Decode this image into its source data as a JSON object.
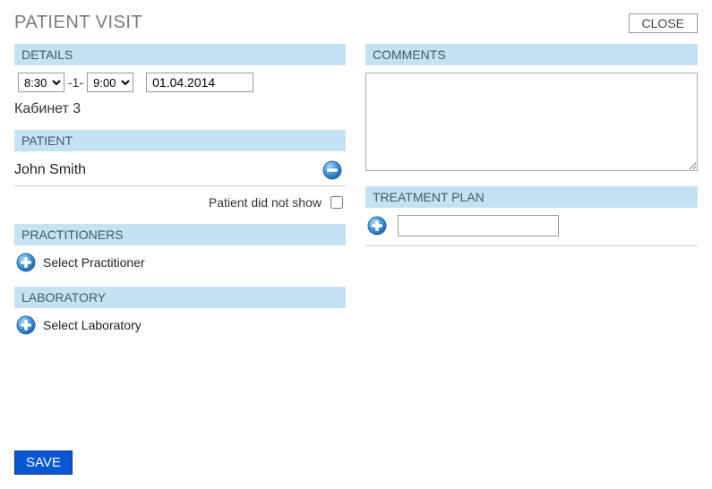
{
  "header": {
    "title": "PATIENT VISIT",
    "close_label": "CLOSE"
  },
  "details": {
    "header": "DETAILS",
    "time_start": "8:30",
    "time_end": "9:00",
    "separator": "-1-",
    "date": "01.04.2014",
    "cabinet": "Кабинет 3"
  },
  "patient": {
    "header": "PATIENT",
    "name": "John Smith",
    "noshow_label": "Patient did not show"
  },
  "practitioners": {
    "header": "PRACTITIONERS",
    "add_label": "Select Practitioner"
  },
  "laboratory": {
    "header": "LABORATORY",
    "add_label": "Select Laboratory"
  },
  "comments": {
    "header": "COMMENTS",
    "value": ""
  },
  "treatment": {
    "header": "TREATMENT PLAN",
    "input_value": ""
  },
  "actions": {
    "save_label": "SAVE"
  }
}
